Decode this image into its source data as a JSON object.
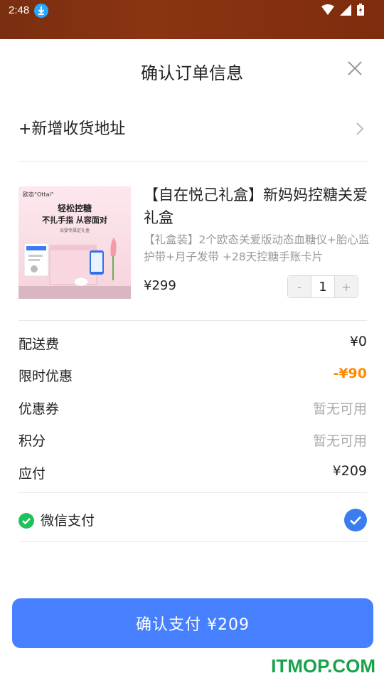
{
  "status_bar": {
    "time": "2:48",
    "icons": [
      "download-icon",
      "wifi-icon",
      "signal-icon",
      "battery-icon"
    ]
  },
  "sheet": {
    "title": "确认订单信息"
  },
  "address": {
    "label": "+新增收货地址"
  },
  "product": {
    "name": "【自在悦己礼盒】新妈妈控糖关爱礼盒",
    "description": "【礼盒装】2个欧态关爱版动态血糖仪+胎心监护带+月子发带 +28天控糖手账卡片",
    "price": "¥299",
    "quantity": "1",
    "minus_label": "-",
    "plus_label": "+",
    "image_text": {
      "brand": "欧态°Ottai°",
      "line1": "轻松控糖",
      "line2": "不扎手指 从容面对",
      "line3": "母婴专属定礼盒"
    }
  },
  "fees": [
    {
      "label": "配送费",
      "value": "¥0"
    },
    {
      "label": "限时优惠",
      "value": "-¥90"
    },
    {
      "label": "优惠券",
      "value": "暂无可用"
    },
    {
      "label": "积分",
      "value": "暂无可用"
    },
    {
      "label": "应付",
      "value": "¥209"
    }
  ],
  "payment": {
    "method": "微信支付",
    "selected": true
  },
  "confirm_button": {
    "label": "确认支付 ¥209"
  },
  "watermark": "ITMOP.COM",
  "colors": {
    "accent": "#4680ff",
    "discount": "#ff8a00",
    "wechat": "#20c05c",
    "status_bar": "#8b3412"
  }
}
